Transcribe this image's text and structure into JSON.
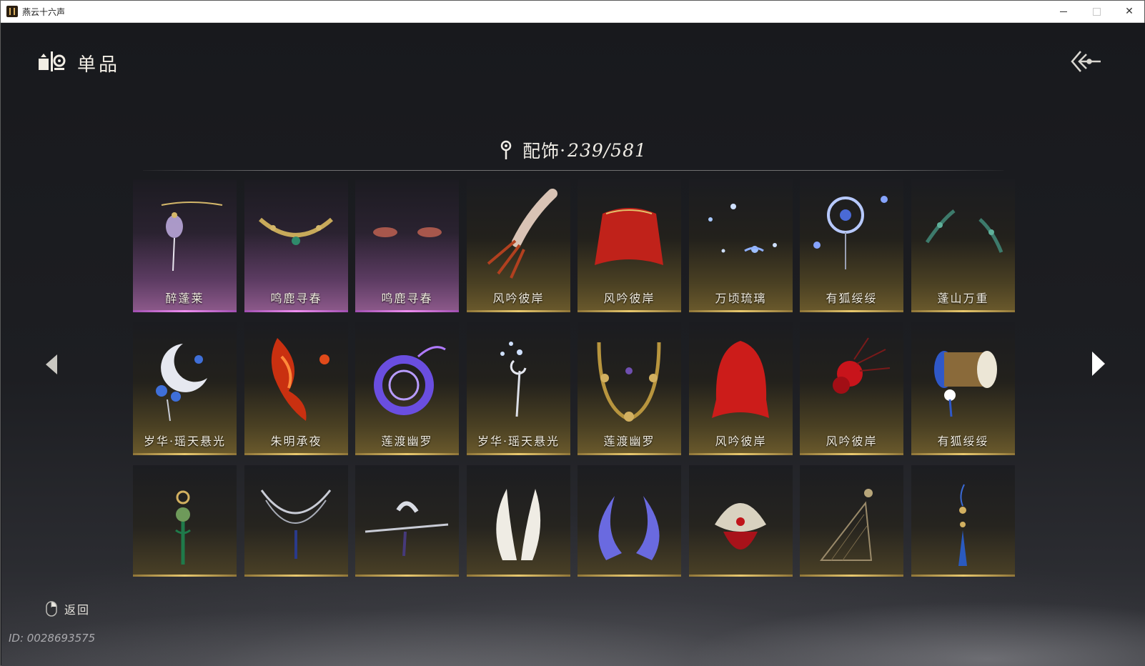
{
  "window": {
    "title": "燕云十六声",
    "minimize_icon": "minimize-icon",
    "maximize_icon": "maximize-icon",
    "close_glyph": "✕"
  },
  "header": {
    "title": "单品",
    "icon": "wardrobe-icon",
    "back_icon": "double-chevron-back-icon"
  },
  "category": {
    "label": "配饰",
    "separator": "·",
    "count": "239/581",
    "icon": "pin-icon"
  },
  "nav": {
    "prev_icon": "triangle-left-icon",
    "next_icon": "triangle-right-icon"
  },
  "items": [
    {
      "label": "醉蓬莱",
      "rarity": "purple",
      "icon": "lantern-hairpin-icon"
    },
    {
      "label": "鸣鹿寻春",
      "rarity": "purple",
      "icon": "gold-necklace-icon"
    },
    {
      "label": "鸣鹿寻春",
      "rarity": "purple",
      "icon": "eye-makeup-icon"
    },
    {
      "label": "风吟彼岸",
      "rarity": "gold",
      "icon": "red-claw-icon"
    },
    {
      "label": "风吟彼岸",
      "rarity": "gold",
      "icon": "red-veil-icon"
    },
    {
      "label": "万顷琉璃",
      "rarity": "gold",
      "icon": "blue-sparkles-icon"
    },
    {
      "label": "有狐绥绥",
      "rarity": "gold",
      "icon": "moon-ring-icon"
    },
    {
      "label": "蓬山万重",
      "rarity": "gold",
      "icon": "jade-branch-icon"
    },
    {
      "label": "岁华·瑶天悬光",
      "rarity": "gold",
      "icon": "moon-headdress-icon"
    },
    {
      "label": "朱明承夜",
      "rarity": "gold",
      "icon": "flame-ornament-icon"
    },
    {
      "label": "莲渡幽罗",
      "rarity": "gold",
      "icon": "purple-spirit-ring-icon"
    },
    {
      "label": "岁华·瑶天悬光",
      "rarity": "gold",
      "icon": "star-hairpin-icon"
    },
    {
      "label": "莲渡幽罗",
      "rarity": "gold",
      "icon": "medallion-necklace-icon"
    },
    {
      "label": "风吟彼岸",
      "rarity": "gold",
      "icon": "red-hood-icon"
    },
    {
      "label": "风吟彼岸",
      "rarity": "gold",
      "icon": "red-spider-lily-icon"
    },
    {
      "label": "有狐绥绥",
      "rarity": "gold",
      "icon": "drum-icon"
    },
    {
      "label": "",
      "rarity": "gold",
      "icon": "jade-pendant-icon"
    },
    {
      "label": "",
      "rarity": "gold",
      "icon": "silver-chain-necklace-icon"
    },
    {
      "label": "",
      "rarity": "gold",
      "icon": "silver-hairpin-icon"
    },
    {
      "label": "",
      "rarity": "gold",
      "icon": "white-horns-icon"
    },
    {
      "label": "",
      "rarity": "gold",
      "icon": "blue-horns-icon"
    },
    {
      "label": "",
      "rarity": "gold",
      "icon": "phoenix-crown-icon"
    },
    {
      "label": "",
      "rarity": "gold",
      "icon": "harp-ornament-icon"
    },
    {
      "label": "",
      "rarity": "gold",
      "icon": "blue-tassel-icon"
    }
  ],
  "footer": {
    "return_label": "返回",
    "return_icon": "mouse-right-click-icon",
    "player_id": "ID: 0028693575"
  }
}
